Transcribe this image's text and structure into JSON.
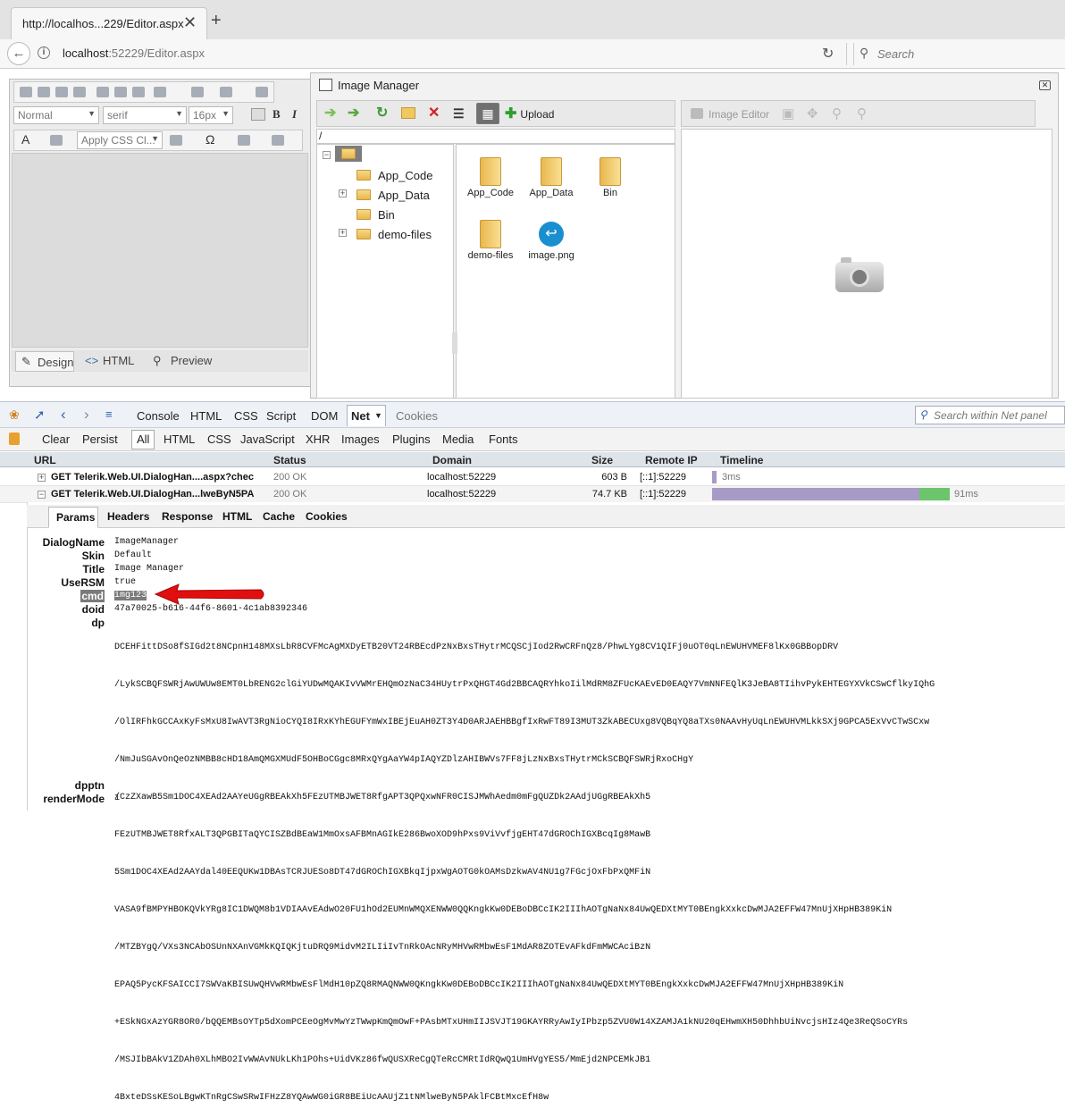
{
  "browser": {
    "tab_title": "http://localhos...229/Editor.aspx",
    "tab_close": "✕",
    "new_tab": "+",
    "url_host": "localhost",
    "url_rest": ":52229/Editor.aspx",
    "search_placeholder": "Search"
  },
  "editor": {
    "format_block": "Normal",
    "font_name": "serif",
    "font_size": "16px",
    "css_class": "Apply CSS Cl...",
    "modes": {
      "design": "Design",
      "html": "HTML",
      "preview": "Preview"
    }
  },
  "image_manager": {
    "title": "Image Manager",
    "upload_label": "Upload",
    "path": "/",
    "tree": [
      "App_Code",
      "App_Data",
      "Bin",
      "demo-files"
    ],
    "grid": [
      "App_Code",
      "App_Data",
      "Bin",
      "demo-files",
      "image.png"
    ],
    "image_editor_label": "Image Editor"
  },
  "devtools": {
    "tabs": [
      "Console",
      "HTML",
      "CSS",
      "Script",
      "DOM",
      "Net",
      "Cookies"
    ],
    "net_tab": "Net",
    "search_placeholder": "Search within Net panel",
    "filters": [
      "Clear",
      "Persist",
      "All",
      "HTML",
      "CSS",
      "JavaScript",
      "XHR",
      "Images",
      "Plugins",
      "Media",
      "Fonts"
    ],
    "columns": {
      "url": "URL",
      "status": "Status",
      "domain": "Domain",
      "size": "Size",
      "remote_ip": "Remote IP",
      "timeline": "Timeline"
    },
    "requests": [
      {
        "url": "GET Telerik.Web.UI.DialogHan....aspx?chec",
        "status": "200 OK",
        "domain": "localhost:52229",
        "size": "603 B",
        "ip": "[::1]:52229",
        "time": "3ms",
        "toggle": "+"
      },
      {
        "url": "GET Telerik.Web.UI.DialogHan...lweByN5PA",
        "status": "200 OK",
        "domain": "localhost:52229",
        "size": "74.7 KB",
        "ip": "[::1]:52229",
        "time": "91ms",
        "toggle": "−"
      }
    ],
    "detail_tabs": [
      "Params",
      "Headers",
      "Response",
      "HTML",
      "Cache",
      "Cookies"
    ],
    "params": [
      {
        "k": "DialogName",
        "v": "ImageManager"
      },
      {
        "k": "Skin",
        "v": "Default"
      },
      {
        "k": "Title",
        "v": "Image Manager"
      },
      {
        "k": "UseRSM",
        "v": "true"
      },
      {
        "k": "cmd",
        "v": "img123"
      },
      {
        "k": "doid",
        "v": "47a70025-b616-44f6-8601-4c1ab8392346"
      }
    ],
    "dp_key": "dp",
    "dp_lines": [
      "DCEHFittDSo8fSIGd2t8NCpnH148MXsLbR8CVFMcAgMXDyETB20VT24RBEcdPzNxBxsTHytrMCQSCjIod2RwCRFnQz8/PhwLYg8CV1QIFj0uOT0qLnEWUHVMEF8lKx0GBBopDRV",
      "/LykSCBQFSWRjAwUWUw8EMT0LbRENG2clGiYUDwMQAKIvVWMrEHQmOzNaC34HUytrPxQHGT4Gd2BBCAQRYhkoIilMdRM8ZFUcKAEvED0EAQY7VmNNFEQlK3JeBA8TIihvPykEHTEGYXVkCSwCflkyIQhG",
      "/OlIRFhkGCCAxKyFsMxU8IwAVT3RgNioCYQI8IRxKYhEGUFYmWxIBEjEuAH0ZT3Y4D0ARJAEHBBgfIxRwFT89I3MUT3ZkABECUxg8VQBqYQ8aTXs0NAAvHyUqLnEWUHVMLkkSXj9GPCA5ExVvCTwSCxw",
      "/NmJuSGAvOnQeOzNMBB8cHD18AmQMGXMUdF5OHBoCGgc8MRxQYgAaYW4pIAQYZDlzAHIBWVs7FF8jLzNxBxsTHytrMCkSCBQFSWRjRxoCHgY",
      "/CzZXawB5Sm1DOC4XEAd2AAYeUGgRBEAkXh5FEzUTMBJWET8RfgAPT3QPQxwNFR0CISJMWhAedm0mFgQUZDk2AAdjUGgRBEAkXh5",
      "FEzUTMBJWET8RfxALT3QPGBITaQYCISZBdBEaW1MmOxsAFBMnAGIkE286BwoXOD9hPxs9ViVvfjgEHT47dGROChIGXBcqIg8MawB",
      "5Sm1DOC4XEAd2AAYdal40EEQUKw1DBAsTCRJUESo8DT47dGROChIGXBkqIjpxWgAOTG0kOAMsDzkwAV4NU1g7FGcjOxFbPxQMFiN",
      "VASA9fBMPYHBOKQVkYRg8IC1DWQM8b1VDIAAvEAdwO20FU1hOd2EUMnWMQXENWW0QQKngkKw0DEBoDBCcIK2IIIhAOTgNaNx84UwQEDXtMYT0BEngkXxkcDwMJA2EFFW47MnUjXHpHB389KiN",
      "/MTZBYgQ/VXs3NCAbOSUnNXAnVGMkKQIQKjtuDRQ9MidvM2ILIiIvTnRkOAcNRyMHVwRMbwEsF1MdAR8ZOTEvAFkdFmMWCAciBzN",
      "EPAQ5PycKFSAICCI7SWVaKBISUwQHVwRMbwEsFlMdH10pZQ8RMAQNWW0QKngkKw0DEBoDBCcIK2IIIhAOTgNaNx84UwQEDXtMYT0BEngkXxkcDwMJA2EFFW47MnUjXHpHB389KiN",
      "+ESkNGxAzYGR8OR0/bQQEMBsOYTp5dXomPCEeOgMvMwYzTWwpKmQmOwF+PAsbMTxUHmIIJSVJT19GKAYRRyAwIyIPbzp5ZVU0W14XZAMJA1kNU20qEHwmXH50DhhbUiNvcjsHIz4Qe3ReQSoCYRs",
      "/MSJIbBAkV1ZDAh0XLhMBO2IvWWAvNUkLKh1POhs+UidVKz86fwQUSXReCgQTeRcCMRtIdRQwQ1UmHVgYES5/MmEjd2NPCEMkJB1",
      "4BxteDSsKESoLBgwKTnRgCSwSRwIFHzZ8YQAwWG0iGR8BEiUcAAUjZ1tNMlweByN5PAklFCBtMxcEfH8w"
    ],
    "tail": [
      {
        "k": "dpptn",
        "v": ""
      },
      {
        "k": "renderMode",
        "v": "1"
      }
    ]
  },
  "colors": {
    "accent_green": "#2e9d2e",
    "delete_red": "#d32020",
    "arrow_red": "#e01010",
    "timeline_purple": "#a89ac6",
    "timeline_green": "#6cc46c"
  }
}
